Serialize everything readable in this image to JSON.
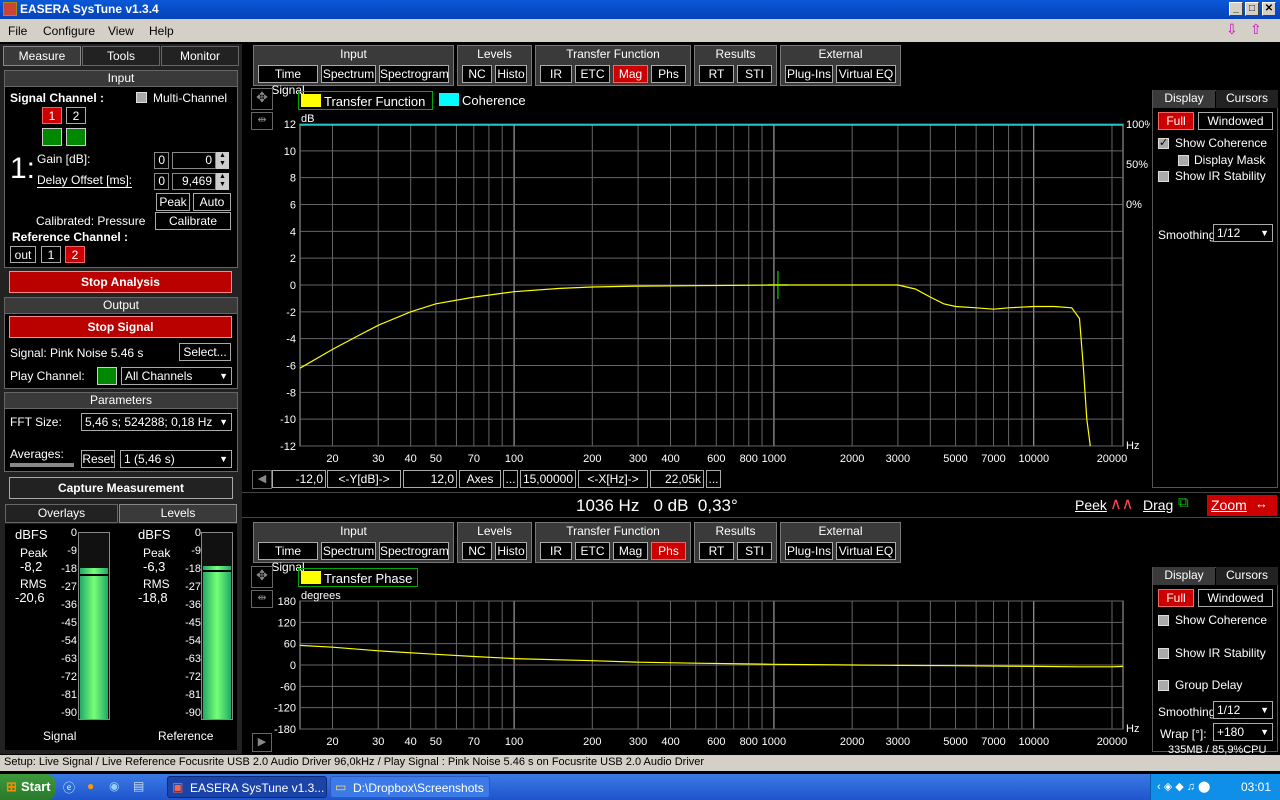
{
  "app": {
    "title": "EASERA SysTune v1.3.4"
  },
  "menu": [
    "File",
    "Configure",
    "View",
    "Help"
  ],
  "left_tabs": [
    "Measure",
    "Tools",
    "Monitor"
  ],
  "input": {
    "header": "Input",
    "signal_channel": "Signal Channel :",
    "multi_channel": "Multi-Channel",
    "ch1": "1",
    "ch2": "2",
    "big_num": "1:",
    "gain_label": "Gain [dB]:",
    "gain_a": "0",
    "gain_b": "0",
    "delay_label": "Delay Offset [ms]:",
    "delay_a": "0",
    "delay_b": "9,469",
    "peak": "Peak",
    "auto": "Auto",
    "calibrated": "Calibrated: Pressure",
    "calibrate": "Calibrate",
    "ref_channel": "Reference Channel :",
    "ref_out": "out",
    "ref_1": "1",
    "ref_2": "2"
  },
  "stop_analysis": "Stop Analysis",
  "output": {
    "header": "Output",
    "stop_signal": "Stop Signal",
    "signal": "Signal: Pink Noise  5.46 s",
    "select": "Select...",
    "play_channel": "Play Channel:",
    "play_value": "All Channels"
  },
  "params": {
    "header": "Parameters",
    "fft_label": "FFT Size:",
    "fft_value": "5,46 s; 524288; 0,18 Hz",
    "avg_label": "Averages:",
    "reset": "Reset",
    "avg_value": "1 (5,46 s)"
  },
  "capture": "Capture Measurement",
  "bottom_tabs": [
    "Overlays",
    "Levels"
  ],
  "levels": {
    "left": {
      "unit": "dBFS",
      "peak_label": "Peak",
      "peak": "-8,2",
      "rms_label": "RMS",
      "rms": "-20,6",
      "name": "Signal",
      "fill": 0.81,
      "mark": 0.78
    },
    "right": {
      "unit": "dBFS",
      "peak_label": "Peak",
      "peak": "-6,3",
      "rms_label": "RMS",
      "rms": "-18,8",
      "name": "Reference",
      "fill": 0.82,
      "mark": 0.8
    },
    "scale": [
      "0",
      "-9",
      "-18",
      "-27",
      "-36",
      "-45",
      "-54",
      "-63",
      "-72",
      "-81",
      "-90"
    ]
  },
  "toolbar": {
    "groups": [
      {
        "title": "Input",
        "buttons": [
          "Time Signal",
          "Spectrum",
          "Spectrogram"
        ]
      },
      {
        "title": "Levels",
        "buttons": [
          "NC",
          "Histo"
        ]
      },
      {
        "title": "Transfer Function",
        "buttons": [
          "IR",
          "ETC",
          "Mag",
          "Phs"
        ]
      },
      {
        "title": "Results",
        "buttons": [
          "RT",
          "STI"
        ]
      },
      {
        "title": "External",
        "buttons": [
          "Plug-Ins",
          "Virtual EQ"
        ]
      }
    ]
  },
  "top_chart": {
    "legend": [
      "Transfer Function",
      "Coherence"
    ],
    "y_unit": "dB",
    "x_unit": "Hz",
    "yticks": [
      "12",
      "10",
      "8",
      "6",
      "4",
      "2",
      "0",
      "-2",
      "-4",
      "-6",
      "-8",
      "-10",
      "-12"
    ],
    "coh_ticks": [
      "100%",
      "50%",
      "0%"
    ],
    "xticks": [
      "20",
      "30",
      "40",
      "50",
      "70",
      "100",
      "200",
      "300",
      "400",
      "600",
      "800",
      "1000",
      "2000",
      "3000",
      "5000",
      "7000",
      "10000",
      "20000"
    ],
    "axis_bar": {
      "ymin": "-12,0",
      "ylabel": "<-Y[dB]->",
      "ymax": "12,0",
      "axes": "Axes",
      "dots": "...",
      "xmin": "15,00000",
      "xlabel": "<-X[Hz]->",
      "xmax": "22,05k",
      "dots2": "..."
    }
  },
  "readout": "1036 Hz   0 dB  0,33°",
  "peek": "Peek",
  "drag": "Drag",
  "zoom": "Zoom",
  "bottom_chart": {
    "legend": [
      "Transfer Phase"
    ],
    "y_unit": "degrees",
    "x_unit": "Hz",
    "yticks": [
      "180",
      "120",
      "60",
      "0",
      "-60",
      "-120",
      "-180"
    ],
    "xticks": [
      "20",
      "30",
      "40",
      "50",
      "70",
      "100",
      "200",
      "300",
      "400",
      "600",
      "800",
      "1000",
      "2000",
      "3000",
      "5000",
      "7000",
      "10000",
      "20000"
    ]
  },
  "display_top": {
    "tabs": [
      "Display",
      "Cursors"
    ],
    "full": "Full",
    "windowed": "Windowed",
    "show_coherence": "Show Coherence",
    "display_mask": "Display Mask",
    "show_ir": "Show IR Stability",
    "smoothing_label": "Smoothing:",
    "smoothing": "1/12"
  },
  "display_bottom": {
    "tabs": [
      "Display",
      "Cursors"
    ],
    "full": "Full",
    "windowed": "Windowed",
    "show_coherence": "Show Coherence",
    "show_ir": "Show IR Stability",
    "group_delay": "Group Delay",
    "smoothing_label": "Smoothing:",
    "smoothing": "1/12",
    "wrap_label": "Wrap [°]:",
    "wrap": "+180"
  },
  "mem": "335MB / 85,9%CPU",
  "status": "Setup: Live Signal / Live Reference Focusrite USB 2.0 Audio Driver 96,0kHz / Play Signal : Pink Noise  5.46 s on Focusrite USB 2.0 Audio Driver",
  "taskbar": {
    "start": "Start",
    "task1": "EASERA SysTune v1.3...",
    "task2": "D:\\Dropbox\\Screenshots",
    "clock": "03:01"
  },
  "chart_data": [
    {
      "type": "line",
      "title": "",
      "xlabel": "Hz",
      "ylabel": "dB",
      "xscale": "log",
      "xlim": [
        15,
        22050
      ],
      "ylim": [
        -12,
        12
      ],
      "series": [
        {
          "name": "Transfer Function",
          "color": "#ffff00",
          "x": [
            15,
            20,
            25,
            30,
            40,
            50,
            70,
            100,
            150,
            200,
            300,
            500,
            1000,
            2000,
            3000,
            3500,
            4000,
            4500,
            5000,
            6000,
            7000,
            8000,
            10000,
            12000,
            14000,
            15000,
            15500,
            16000,
            16500
          ],
          "y": [
            -6.2,
            -4.8,
            -3.8,
            -3.0,
            -2.0,
            -1.4,
            -0.9,
            -0.5,
            -0.25,
            -0.15,
            -0.08,
            -0.05,
            0,
            0,
            0,
            -0.3,
            -0.9,
            -1.4,
            -1.6,
            -1.7,
            -1.8,
            -1.7,
            -1.6,
            -1.6,
            -1.7,
            -2.5,
            -6,
            -10,
            -12
          ]
        },
        {
          "name": "Coherence",
          "color": "#00ffff",
          "x": [
            15,
            22050
          ],
          "y": [
            100,
            100
          ]
        }
      ]
    },
    {
      "type": "line",
      "title": "",
      "xlabel": "Hz",
      "ylabel": "degrees",
      "xscale": "log",
      "xlim": [
        15,
        22050
      ],
      "ylim": [
        -180,
        180
      ],
      "series": [
        {
          "name": "Transfer Phase",
          "color": "#ffff00",
          "x": [
            15,
            20,
            30,
            50,
            70,
            100,
            200,
            300,
            500,
            1000,
            2000,
            3000,
            5000,
            10000,
            15000,
            20000,
            22050
          ],
          "y": [
            55,
            50,
            40,
            30,
            24,
            18,
            12,
            8,
            5,
            2,
            0,
            -1,
            -2,
            -4,
            -5,
            -5,
            -4
          ]
        }
      ]
    }
  ]
}
